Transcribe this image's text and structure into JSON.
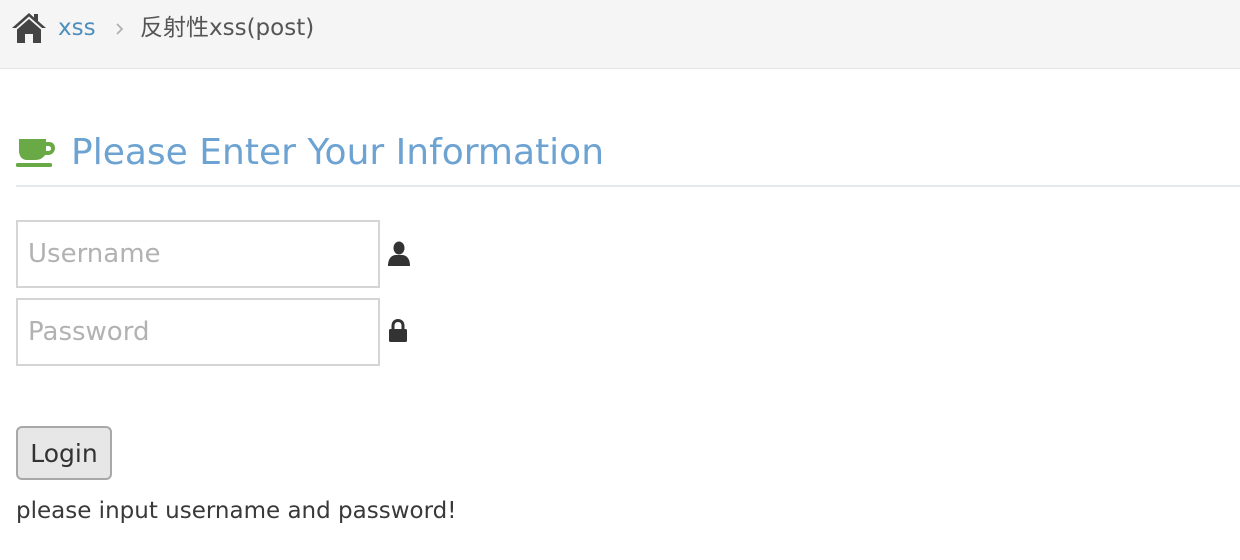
{
  "breadcrumb": {
    "home_icon": "home-icon",
    "link": "xss",
    "separator_icon": "chevron-right-icon",
    "active": "反射性xss(post)"
  },
  "header": {
    "icon": "coffee-cup-icon",
    "title": "Please Enter Your Information",
    "title_color": "#6da3d2",
    "icon_color": "#69aa46"
  },
  "form": {
    "username": {
      "placeholder": "Username",
      "value": "",
      "icon": "user-icon"
    },
    "password": {
      "placeholder": "Password",
      "value": "",
      "icon": "lock-icon"
    },
    "login_label": "Login"
  },
  "status": {
    "message": "please input username and password!"
  }
}
